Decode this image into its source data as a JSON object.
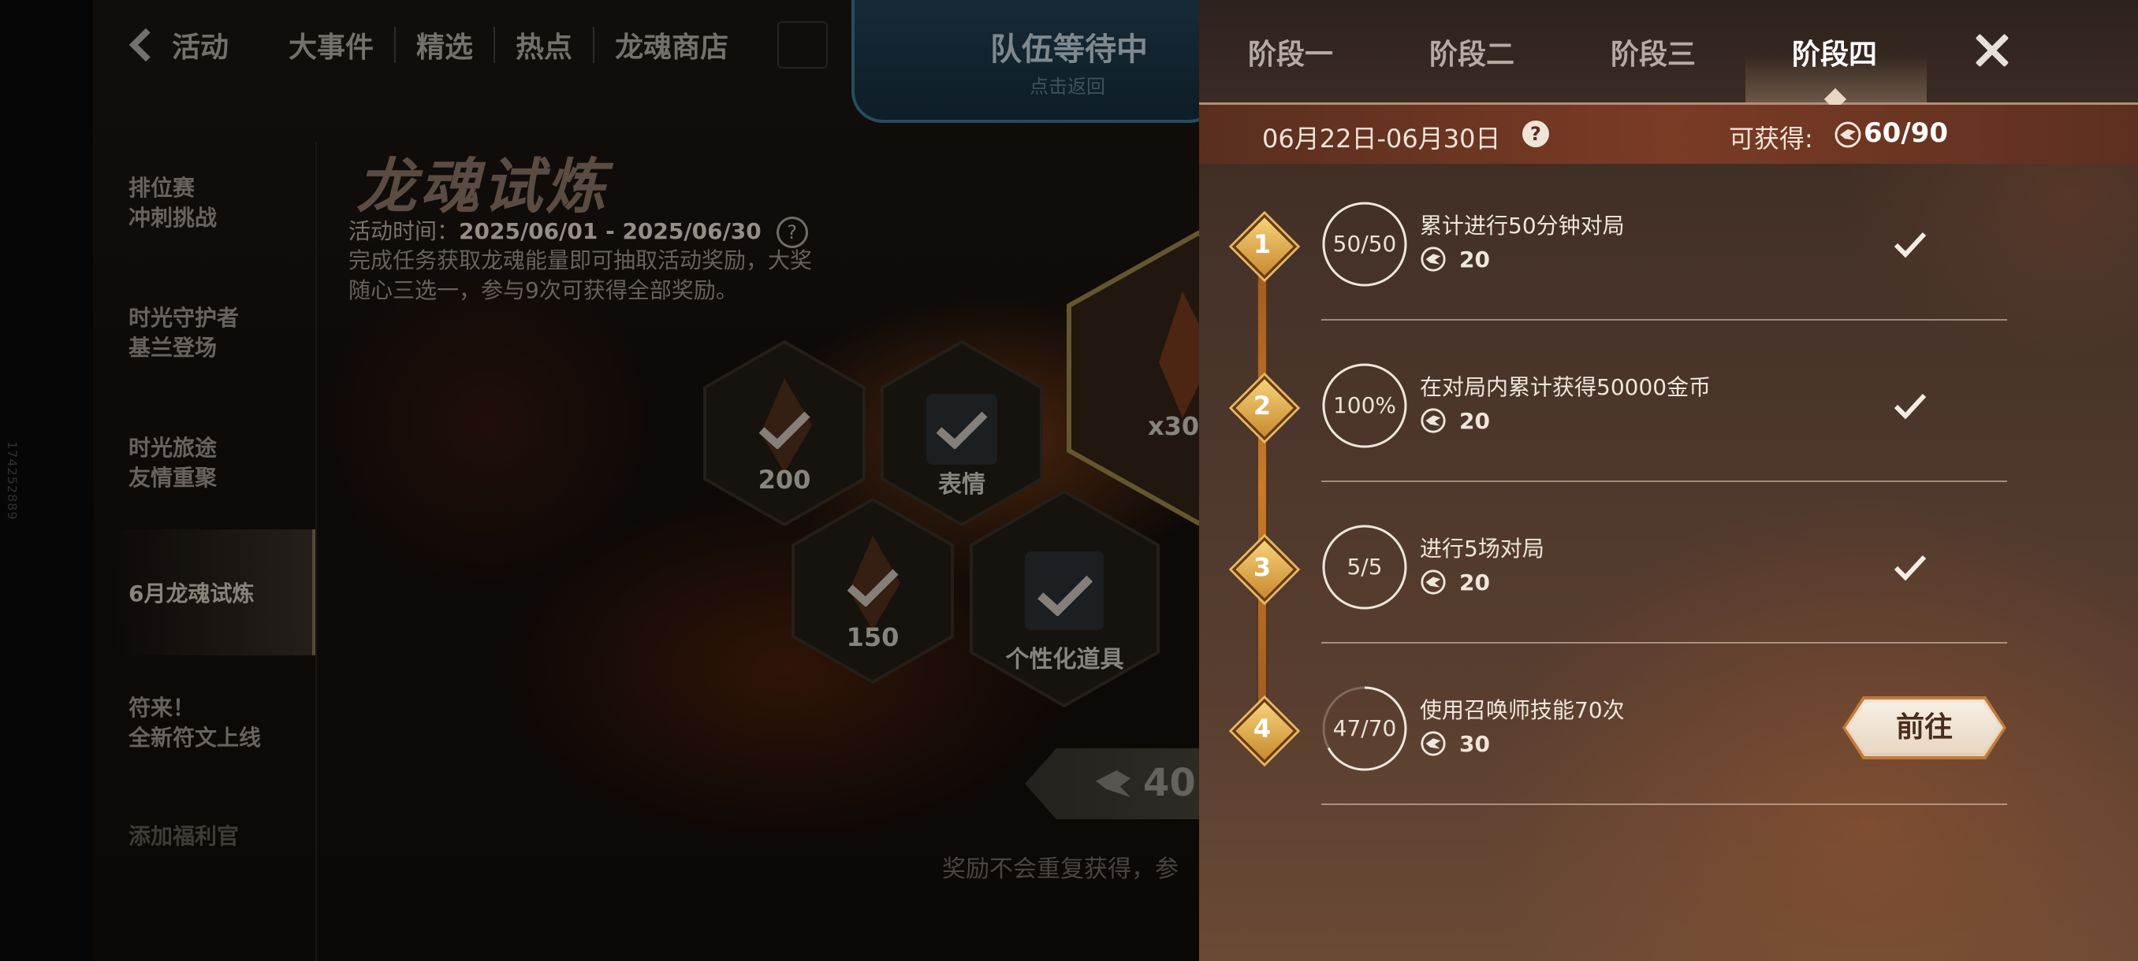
{
  "left": {
    "side_id": "174252889",
    "nav": {
      "back_label": "活动",
      "items": [
        "大事件",
        "精选",
        "热点",
        "龙魂商店"
      ]
    },
    "team_banner": {
      "title": "队伍等待中",
      "subtitle": "点击返回"
    },
    "sidebar": [
      {
        "line1": "排位赛",
        "line2": "冲刺挑战"
      },
      {
        "line1": "时光守护者",
        "line2": "基兰登场"
      },
      {
        "line1": "时光旅途",
        "line2": "友情重聚"
      },
      {
        "line1": "6月龙魂试炼",
        "line2": ""
      },
      {
        "line1": "符来！",
        "line2": "全新符文上线"
      },
      {
        "line1": "添加福利官",
        "line2": ""
      }
    ],
    "event": {
      "title": "龙魂试炼",
      "time_label": "活动时间：",
      "time_value": "2025/06/01 - 2025/06/30",
      "desc_line1": "完成任务获取龙魂能量即可抽取活动奖励，大奖",
      "desc_line2": "随心三选一，参与9次可获得全部奖励。"
    },
    "hexes": [
      {
        "label": "200"
      },
      {
        "label": "表情"
      },
      {
        "label": "150"
      },
      {
        "label": "个性化道具"
      },
      {
        "label": "x30"
      }
    ],
    "reward_value": "40",
    "reward_note": "奖励不会重复获得，参"
  },
  "panel": {
    "tabs": [
      "阶段一",
      "阶段二",
      "阶段三",
      "阶段四"
    ],
    "active_tab": 3,
    "date_range": "06月22日-06月30日",
    "gain_label": "可获得:",
    "gain_value": "60/90",
    "tasks": [
      {
        "index": "1",
        "progress_text": "50/50",
        "progress": 1.0,
        "title": "累计进行50分钟对局",
        "reward": "20",
        "status": "done"
      },
      {
        "index": "2",
        "progress_text": "100%",
        "progress": 1.0,
        "title": "在对局内累计获得50000金币",
        "reward": "20",
        "status": "done"
      },
      {
        "index": "3",
        "progress_text": "5/5",
        "progress": 1.0,
        "title": "进行5场对局",
        "reward": "20",
        "status": "done"
      },
      {
        "index": "4",
        "progress_text": "47/70",
        "progress": 0.671,
        "title": "使用召唤师技能70次",
        "reward": "30",
        "status": "go"
      }
    ],
    "goto_label": "前往"
  },
  "colors": {
    "accent_gold": "#e5b860",
    "panel_bg": "#4a352b",
    "date_strip": "#7a3b25"
  }
}
